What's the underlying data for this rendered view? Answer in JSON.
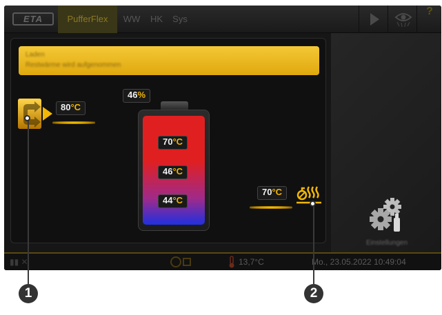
{
  "topbar": {
    "logo_text": "ETA",
    "tabs": [
      "PufferFlex",
      "WW",
      "HK",
      "Sys"
    ],
    "active_tab": "PufferFlex",
    "help_label": "?"
  },
  "banner": {
    "line1": "Laden",
    "line2": "Restwärme wird aufgenommen"
  },
  "inlet": {
    "temperature": "80",
    "unit": "°C"
  },
  "tank": {
    "charge_value": "46",
    "charge_unit": "%",
    "charge_percent": 46,
    "top_temp": "70",
    "mid_temp": "46",
    "bottom_temp": "44",
    "unit": "°C"
  },
  "outlet": {
    "temperature": "70",
    "unit": "°C"
  },
  "settings": {
    "label": "Einstellungen"
  },
  "statusbar": {
    "outdoor_temp": "13,7°C",
    "datetime": "Mo., 23.05.2022 10:49:04"
  },
  "callouts": [
    "1",
    "2"
  ],
  "colors": {
    "accent_yellow": "#f2b705",
    "banner_yellow": "#f0c030",
    "tank_hot": "#e02020",
    "tank_cold": "#2030e0",
    "background": "#161616"
  }
}
